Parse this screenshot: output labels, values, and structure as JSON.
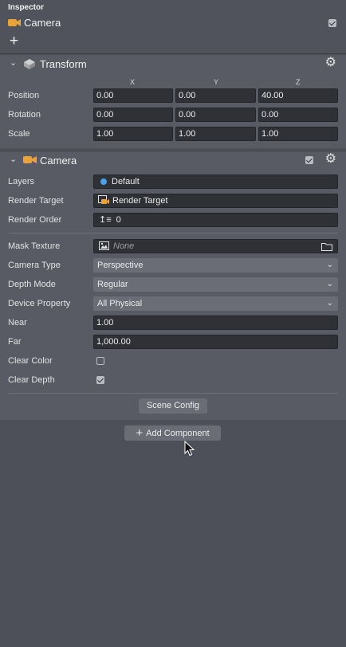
{
  "inspector": {
    "title": "Inspector",
    "node_name": "Camera",
    "node_enabled": true,
    "add_label": "+"
  },
  "transform": {
    "title": "Transform",
    "axes": [
      "X",
      "Y",
      "Z"
    ],
    "rows": [
      {
        "label": "Position",
        "values": [
          "0.00",
          "0.00",
          "40.00"
        ]
      },
      {
        "label": "Rotation",
        "values": [
          "0.00",
          "0.00",
          "0.00"
        ]
      },
      {
        "label": "Scale",
        "values": [
          "1.00",
          "1.00",
          "1.00"
        ]
      }
    ]
  },
  "camera": {
    "title": "Camera",
    "enabled": true,
    "layers": {
      "label": "Layers",
      "value": "Default"
    },
    "render_target": {
      "label": "Render Target",
      "value": "Render Target"
    },
    "render_order": {
      "label": "Render Order",
      "value": "0"
    },
    "mask_texture": {
      "label": "Mask Texture",
      "value": "None"
    },
    "camera_type": {
      "label": "Camera Type",
      "value": "Perspective"
    },
    "depth_mode": {
      "label": "Depth Mode",
      "value": "Regular"
    },
    "device_property": {
      "label": "Device Property",
      "value": "All Physical"
    },
    "near": {
      "label": "Near",
      "value": "1.00"
    },
    "far": {
      "label": "Far",
      "value": "1,000.00"
    },
    "clear_color": {
      "label": "Clear Color",
      "checked": false
    },
    "clear_depth": {
      "label": "Clear Depth",
      "checked": true
    },
    "scene_config_label": "Scene Config"
  },
  "add_component_label": "Add Component",
  "colors": {
    "panel_bg": "#4d5059",
    "section_bg": "#585b63",
    "field_bg": "#2f3136",
    "accent_orange": "#e8a33a",
    "layer_dot": "#4aa3e8"
  }
}
